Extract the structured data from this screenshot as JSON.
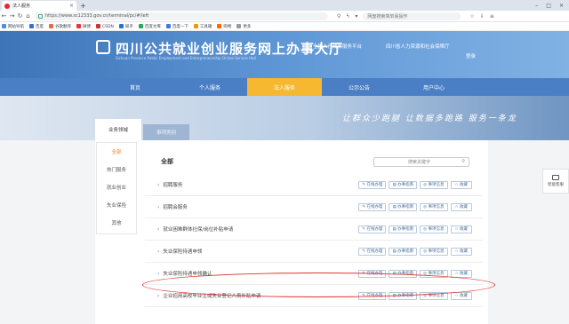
{
  "browser": {
    "tab_title": "法人服务",
    "url": "https://www.sc12333.gov.cn/terminal/pc/#/left",
    "search_placeholder": "网盘搜索简单易操作",
    "bookmarks": [
      "网站导航",
      "百度",
      "谷歌翻译",
      "微博",
      "CSDN",
      "知乎",
      "百度文库",
      "百度一下",
      "工具箱",
      "购物",
      "更多"
    ]
  },
  "header": {
    "site_title": "四川公共就业创业服务网上办事大厅",
    "site_subtitle": "Sichuan Province Public Employment and Entrepreneurship Online Service Hall",
    "link1": "全国人社政务服务平台",
    "link2": "四川省人力资源和社会保障厅",
    "login": "登录"
  },
  "nav": {
    "items": [
      "首页",
      "个人服务",
      "法人服务",
      "公示公告",
      "用户中心"
    ],
    "active_index": 2
  },
  "hero": {
    "slogan": "让群众少跑腿 让数据多跑路 服务一条龙",
    "tab_active": "业务领域",
    "tab_inactive": "事项类别"
  },
  "sidebar": {
    "items": [
      "全部",
      "热门服务",
      "就业创业",
      "失业保险",
      "其他"
    ],
    "active_index": 0
  },
  "list": {
    "heading": "全部",
    "search_placeholder": "搜索关键字",
    "buttons": [
      "在线办理",
      "办事指南",
      "事项信息",
      "收藏"
    ],
    "rows": [
      "招聘服务",
      "招聘会服务",
      "就业困难群体社保/岗位补贴申请",
      "失业保险待遇申领",
      "失业保险待遇申领确认",
      "企业招用高校毕业生或失业登记人员补贴申请"
    ],
    "highlighted_index": 4
  },
  "right_widget": {
    "label": "智能客服"
  }
}
